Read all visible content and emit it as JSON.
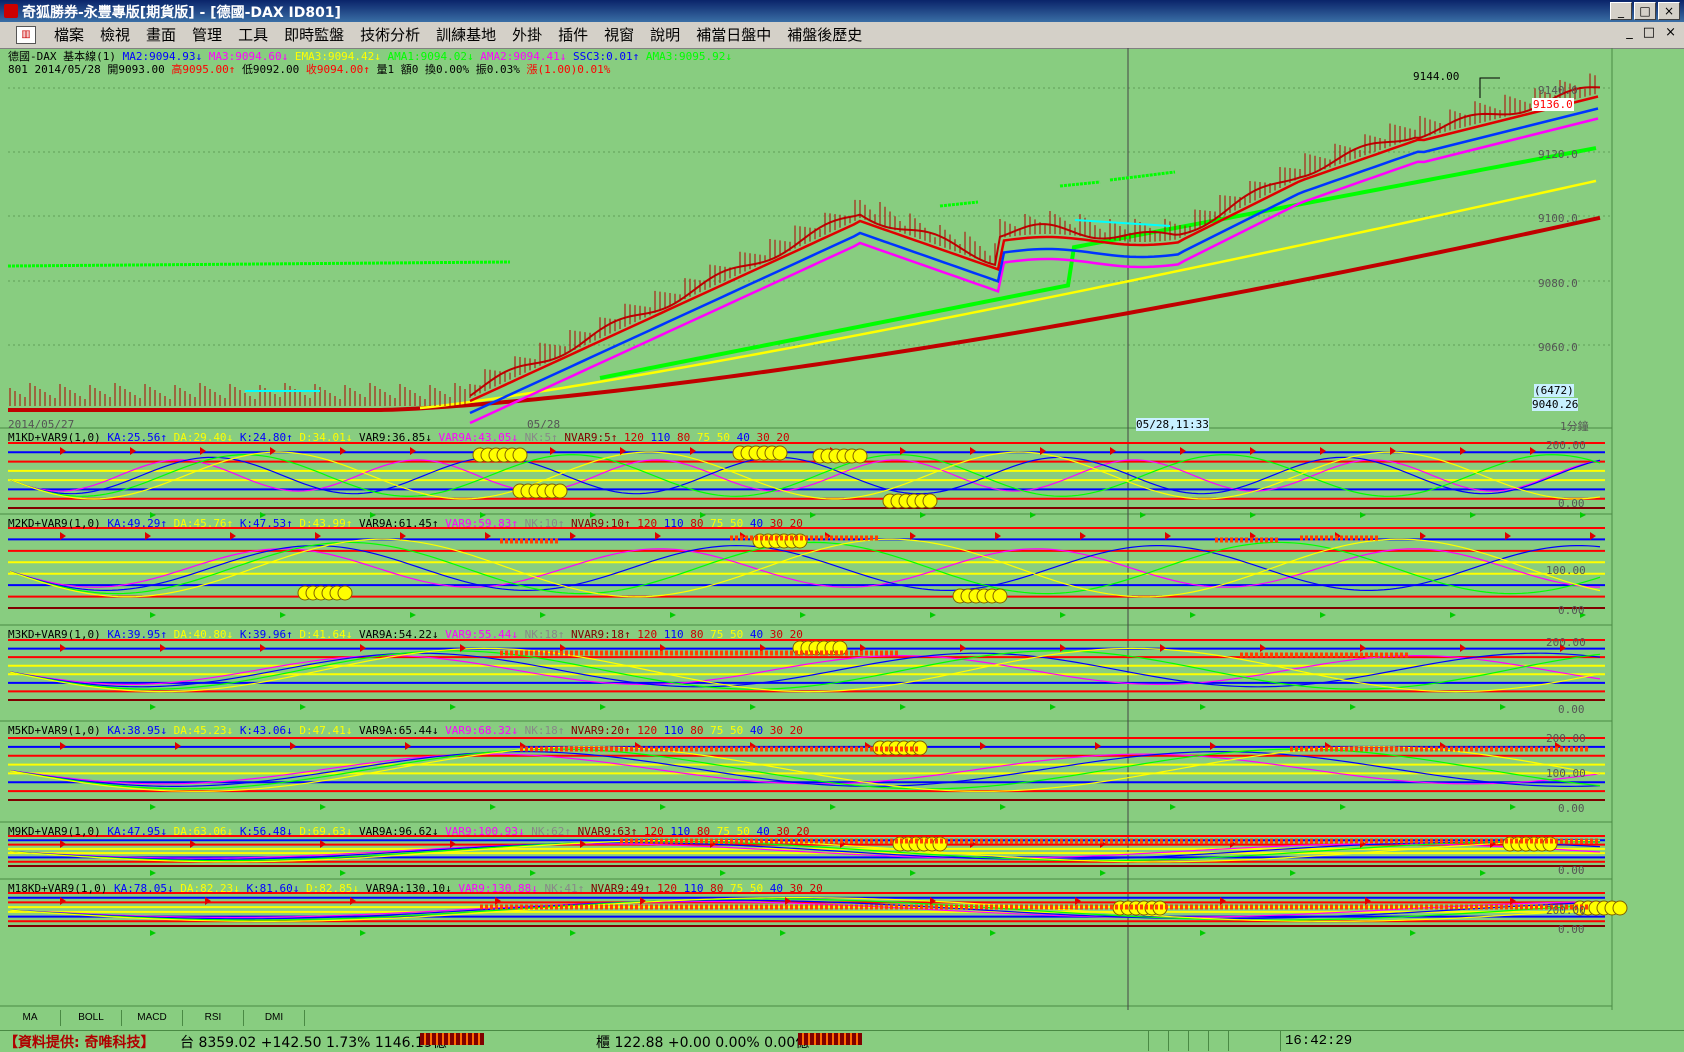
{
  "window": {
    "title": "奇狐勝券-永豐專版[期貨版] - [德國-DAX ID801]",
    "buttons": [
      "_",
      "□",
      "×"
    ]
  },
  "menu": {
    "items": [
      "檔案",
      "檢視",
      "畫面",
      "管理",
      "工具",
      "即時監盤",
      "技術分析",
      "訓練基地",
      "外掛",
      "插件",
      "視窗",
      "說明",
      "補當日盤中",
      "補盤後歷史"
    ],
    "mdi_buttons": [
      "_",
      "□",
      "×"
    ]
  },
  "main_panel": {
    "legend": {
      "name": "德國-DAX 基本線(1)",
      "ma2": "MA2:9094.93↓",
      "ma3": "MA3:9094.60↓",
      "ema3": "EMA3:9094.42↓",
      "ama1": "AMA1:9094.02↓",
      "ama2": "AMA2:9094.41↓",
      "ssc3": "SSC3:0.01↑",
      "ama3": "AMA3:9095.92↓"
    },
    "quote": {
      "id_date": "801 2014/05/28",
      "open": "開9093.00",
      "high": "高9095.00↑",
      "low": "低9092.00",
      "close": "收9094.00↑",
      "vol": "量1 額0 換0.00% 振0.03%",
      "change": "漲(1.00)0.01%"
    },
    "peak_label": "9144.00",
    "price_badge": "9136.0",
    "y_ticks": [
      "9140.0",
      "9120.0",
      "9100.0",
      "9080.0",
      "9060.0"
    ],
    "bottom_left_label": "(6472)",
    "bottom_price": "9040.26",
    "date_left": "2014/05/27",
    "date_mid": "05/28",
    "crosshair_time": "05/28,11:33",
    "period": "1分鐘",
    "colors": {
      "candle_up": "#ff0000",
      "ma_blue": "#0000ff",
      "ma_yellow": "#ffff00",
      "ma_magenta": "#ff00ff",
      "ma_green": "#00ff00",
      "bg": "#88cd80"
    }
  },
  "kd_panels": [
    {
      "legend": [
        "M1KD+VAR9(1,0)",
        "KA:25.56↑",
        "DA:29.40↓",
        "K:24.80↑",
        "D:34.01↓",
        "VAR9:36.85↓",
        "VAR9A:43.05↓",
        "NK:5↑",
        "NVAR9:5↑"
      ],
      "ticks": [
        "200.00",
        "0.00"
      ],
      "levels": [
        "120",
        "110",
        "80",
        "75",
        "50",
        "40",
        "30",
        "20"
      ]
    },
    {
      "legend": [
        "M2KD+VAR9(1,0)",
        "KA:49.29↑",
        "DA:45.76↑",
        "K:47.53↑",
        "D:43.99↑",
        "VAR9A:61.45↑",
        "VAR9:59.83↑",
        "NK:10↑",
        "NVAR9:10↑"
      ],
      "ticks": [
        "100.00",
        "0.00"
      ],
      "levels": [
        "120",
        "110",
        "80",
        "75",
        "50",
        "40",
        "30",
        "20"
      ]
    },
    {
      "legend": [
        "M3KD+VAR9(1,0)",
        "KA:39.95↑",
        "DA:40.80↓",
        "K:39.96↑",
        "D:41.64↓",
        "VAR9A:54.22↓",
        "VAR9:55.44↓",
        "NK:18↑",
        "NVAR9:18↑"
      ],
      "ticks": [
        "200.00",
        "0.00"
      ],
      "levels": [
        "120",
        "110",
        "80",
        "75",
        "50",
        "40",
        "30",
        "20"
      ]
    },
    {
      "legend": [
        "M5KD+VAR9(1,0)",
        "KA:38.95↓",
        "DA:45.23↓",
        "K:43.06↓",
        "D:47.41↓",
        "VAR9A:65.44↓",
        "VAR9:68.32↓",
        "NK:18↑",
        "NVAR9:20↑"
      ],
      "ticks": [
        "200.00",
        "100.00",
        "0.00"
      ],
      "levels": [
        "120",
        "110",
        "80",
        "75",
        "50",
        "40",
        "30",
        "20"
      ]
    },
    {
      "legend": [
        "M9KD+VAR9(1,0)",
        "KA:47.95↓",
        "DA:63.06↓",
        "K:56.48↓",
        "D:69.63↓",
        "VAR9A:96.62↓",
        "VAR9:100.93↓",
        "NK:62↑",
        "NVAR9:63↑"
      ],
      "ticks": [
        "0.00"
      ],
      "levels": [
        "120",
        "110",
        "80",
        "75",
        "50",
        "40",
        "30",
        "20"
      ]
    },
    {
      "legend": [
        "M18KD+VAR9(1,0)",
        "KA:78.05↓",
        "DA:82.23↓",
        "K:81.60↓",
        "D:82.85↓",
        "VAR9A:130.10↓",
        "VAR9:130.88↓",
        "NK:41↑",
        "NVAR9:49↑"
      ],
      "ticks": [
        "200.00",
        "0.00"
      ],
      "levels": [
        "120",
        "110",
        "80",
        "75",
        "50",
        "40",
        "30",
        "20"
      ]
    }
  ],
  "bottom_tabs": [
    "MA",
    "BOLL",
    "MACD",
    "RSI",
    "DMI"
  ],
  "status": {
    "source": "【資料提供: 奇唯科技】",
    "tw_index": "台 8359.02 +142.50 1.73% 1146.19億",
    "otc_index": "櫃 122.88 +0.00 0.00% 0.00億",
    "time": "16:42:29"
  }
}
